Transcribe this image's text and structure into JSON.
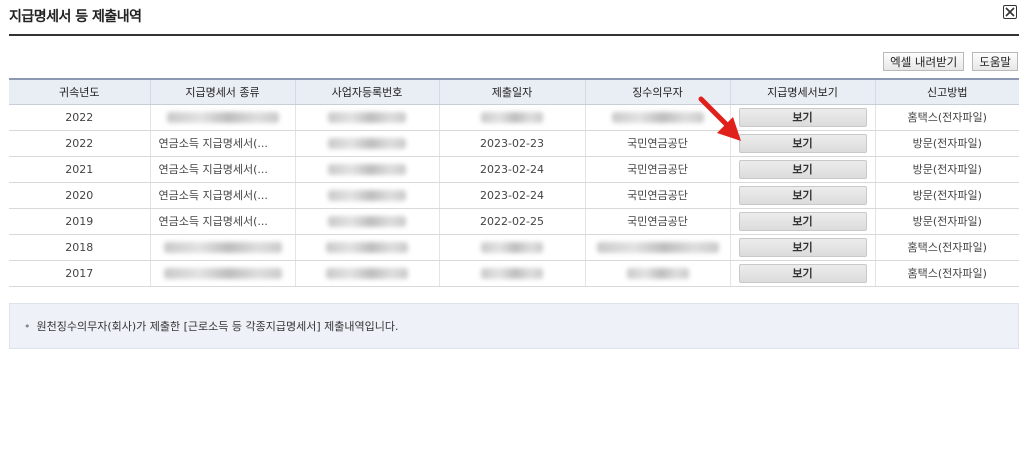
{
  "page": {
    "title": "지급명세서 등 제출내역"
  },
  "toolbar": {
    "excel_download": "엑셀 내려받기",
    "help": "도움말"
  },
  "table": {
    "headers": [
      "귀속년도",
      "지급명세서 종류",
      "사업자등록번호",
      "제출일자",
      "징수의무자",
      "지급명세서보기",
      "신고방법"
    ],
    "rows": [
      {
        "year": "2022",
        "type": "",
        "bizno": "",
        "date": "",
        "payer": "",
        "view": "보기",
        "method": "홈택스(전자파일)"
      },
      {
        "year": "2022",
        "type": "연금소득 지급명세서(...",
        "bizno": "",
        "date": "2023-02-23",
        "payer": "국민연금공단",
        "view": "보기",
        "method": "방문(전자파일)"
      },
      {
        "year": "2021",
        "type": "연금소득 지급명세서(...",
        "bizno": "",
        "date": "2023-02-24",
        "payer": "국민연금공단",
        "view": "보기",
        "method": "방문(전자파일)"
      },
      {
        "year": "2020",
        "type": "연금소득 지급명세서(...",
        "bizno": "",
        "date": "2023-02-24",
        "payer": "국민연금공단",
        "view": "보기",
        "method": "방문(전자파일)"
      },
      {
        "year": "2019",
        "type": "연금소득 지급명세서(...",
        "bizno": "",
        "date": "2022-02-25",
        "payer": "국민연금공단",
        "view": "보기",
        "method": "방문(전자파일)"
      },
      {
        "year": "2018",
        "type": "",
        "bizno": "",
        "date": "",
        "payer": "",
        "view": "보기",
        "method": "홈택스(전자파일)"
      },
      {
        "year": "2017",
        "type": "",
        "bizno": "",
        "date": "",
        "payer": "",
        "view": "보기",
        "method": "홈택스(전자파일)"
      }
    ]
  },
  "notice": {
    "text": "원천징수의무자(회사)가 제출한 [근로소득 등 각종지급명세서] 제출내역입니다."
  },
  "icons": {
    "close": "close-icon",
    "annotation": "red-arrow-annotation"
  },
  "colors": {
    "header_bg": "#e9edf4",
    "header_border": "#8c99b3",
    "notice_bg": "#eef2f8",
    "arrow": "#e0201b"
  }
}
